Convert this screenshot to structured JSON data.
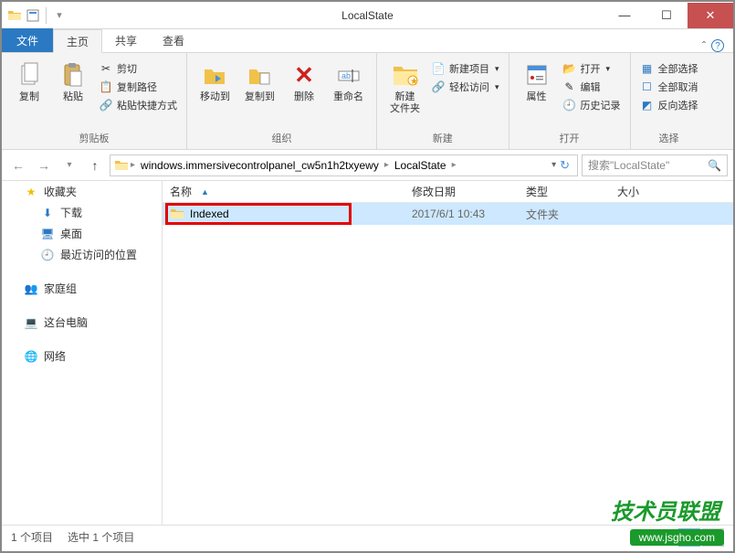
{
  "window": {
    "title": "LocalState"
  },
  "tabs": {
    "file": "文件",
    "home": "主页",
    "share": "共享",
    "view": "查看"
  },
  "ribbon": {
    "clipboard": {
      "label": "剪贴板",
      "copy": "复制",
      "paste": "粘贴",
      "cut": "剪切",
      "copypath": "复制路径",
      "pastelink": "粘贴快捷方式"
    },
    "organize": {
      "label": "组织",
      "moveto": "移动到",
      "copyto": "复制到",
      "delete": "删除",
      "rename": "重命名"
    },
    "new": {
      "label": "新建",
      "newfolder": "新建\n文件夹",
      "newitem": "新建项目",
      "easyaccess": "轻松访问"
    },
    "open": {
      "label": "打开",
      "props": "属性",
      "open": "打开",
      "edit": "编辑",
      "history": "历史记录"
    },
    "select": {
      "label": "选择",
      "all": "全部选择",
      "none": "全部取消",
      "invert": "反向选择"
    }
  },
  "breadcrumb": {
    "a": "windows.immersivecontrolpanel_cw5n1h2txyewy",
    "b": "LocalState"
  },
  "search": {
    "placeholder": "搜索\"LocalState\""
  },
  "columns": {
    "name": "名称",
    "date": "修改日期",
    "type": "类型",
    "size": "大小"
  },
  "row": {
    "name": "Indexed",
    "date": "2017/6/1 10:43",
    "type": "文件夹"
  },
  "sidebar": {
    "fav": "收藏夹",
    "downloads": "下载",
    "desktop": "桌面",
    "recent": "最近访问的位置",
    "homegroup": "家庭组",
    "thispc": "这台电脑",
    "network": "网络"
  },
  "status": {
    "items": "1 个项目",
    "sel": "选中 1 个项目"
  },
  "watermark": {
    "text": "技术员联盟",
    "url": "www.jsgho.com"
  }
}
